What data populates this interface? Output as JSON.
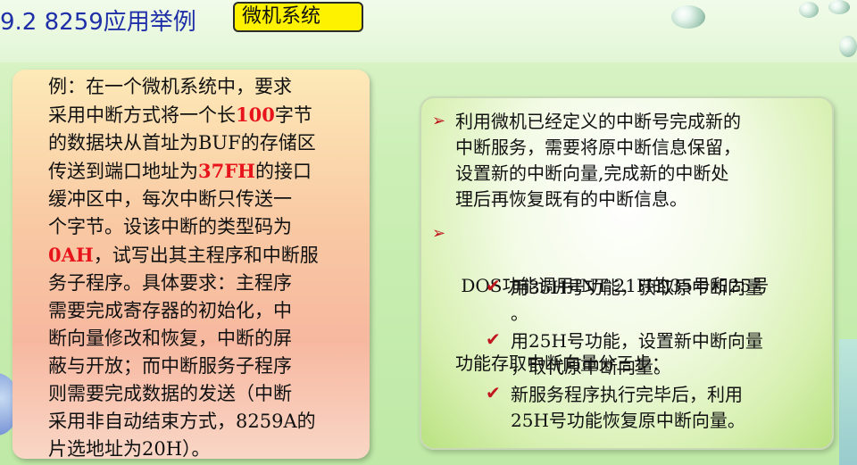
{
  "header": {
    "title": "9.2 8259应用举例",
    "tag": "微机系统"
  },
  "left": {
    "lines": [
      [
        {
          "t": "例：在一个微机系统中，要求"
        }
      ],
      [
        {
          "t": "采用中断方式将一个长"
        },
        {
          "t": "100",
          "red": true
        },
        {
          "t": "字节"
        }
      ],
      [
        {
          "t": "的数据块从首址为BUF的存储区"
        }
      ],
      [
        {
          "t": "传送到端口地址为"
        },
        {
          "t": "37FH",
          "red": true
        },
        {
          "t": "的接口"
        }
      ],
      [
        {
          "t": "缓冲区中，每次中断只传送一"
        }
      ],
      [
        {
          "t": "个字节。设该中断的类型码为"
        }
      ],
      [
        {
          "t": "0AH",
          "red": true
        },
        {
          "t": "，试写出其主程序和中断服"
        }
      ],
      [
        {
          "t": "务子程序。具体要求：主程序"
        }
      ],
      [
        {
          "t": "需要完成寄存器的初始化，中"
        }
      ],
      [
        {
          "t": "断向量修改和恢复，中断的屏"
        }
      ],
      [
        {
          "t": "蔽与开放；而中断服务子程序"
        }
      ],
      [
        {
          "t": "则需要完成数据的发送（中断"
        }
      ],
      [
        {
          "t": "采用非自动结束方式，8259A的"
        }
      ],
      [
        {
          "t": "片选地址为20H）。"
        }
      ]
    ]
  },
  "right": {
    "bullet1": {
      "icon": "arrow-bullet-icon",
      "lines": [
        "利用微机已经定义的中断号完成新的",
        "中断服务，需要将原中断信息保留，",
        "设置新的中断向量,完成新的中断处",
        "理后再恢复既有的中断信息。"
      ]
    },
    "bullet2": {
      "icon": "arrow-bullet-icon",
      "lines": [
        " DOS功能调用INT 21H的35号和25号",
        "功能存取中断向量分三步："
      ]
    },
    "steps": [
      {
        "icon": "checkmark-icon",
        "lines": [
          "用35H号功能，获取原中断向量",
          "。"
        ]
      },
      {
        "icon": "checkmark-icon",
        "lines": [
          "用25H号功能，设置新中断向量",
          "，取代原中断向量。"
        ]
      },
      {
        "icon": "checkmark-icon",
        "lines": [
          "新服务程序执行完毕后，利用",
          "25H号功能恢复原中断向量。"
        ]
      }
    ]
  },
  "colors": {
    "title": "#1f2fa8",
    "tag_bg": "#fff200",
    "highlight": "#e8141c",
    "bullet": "#c0181e"
  }
}
